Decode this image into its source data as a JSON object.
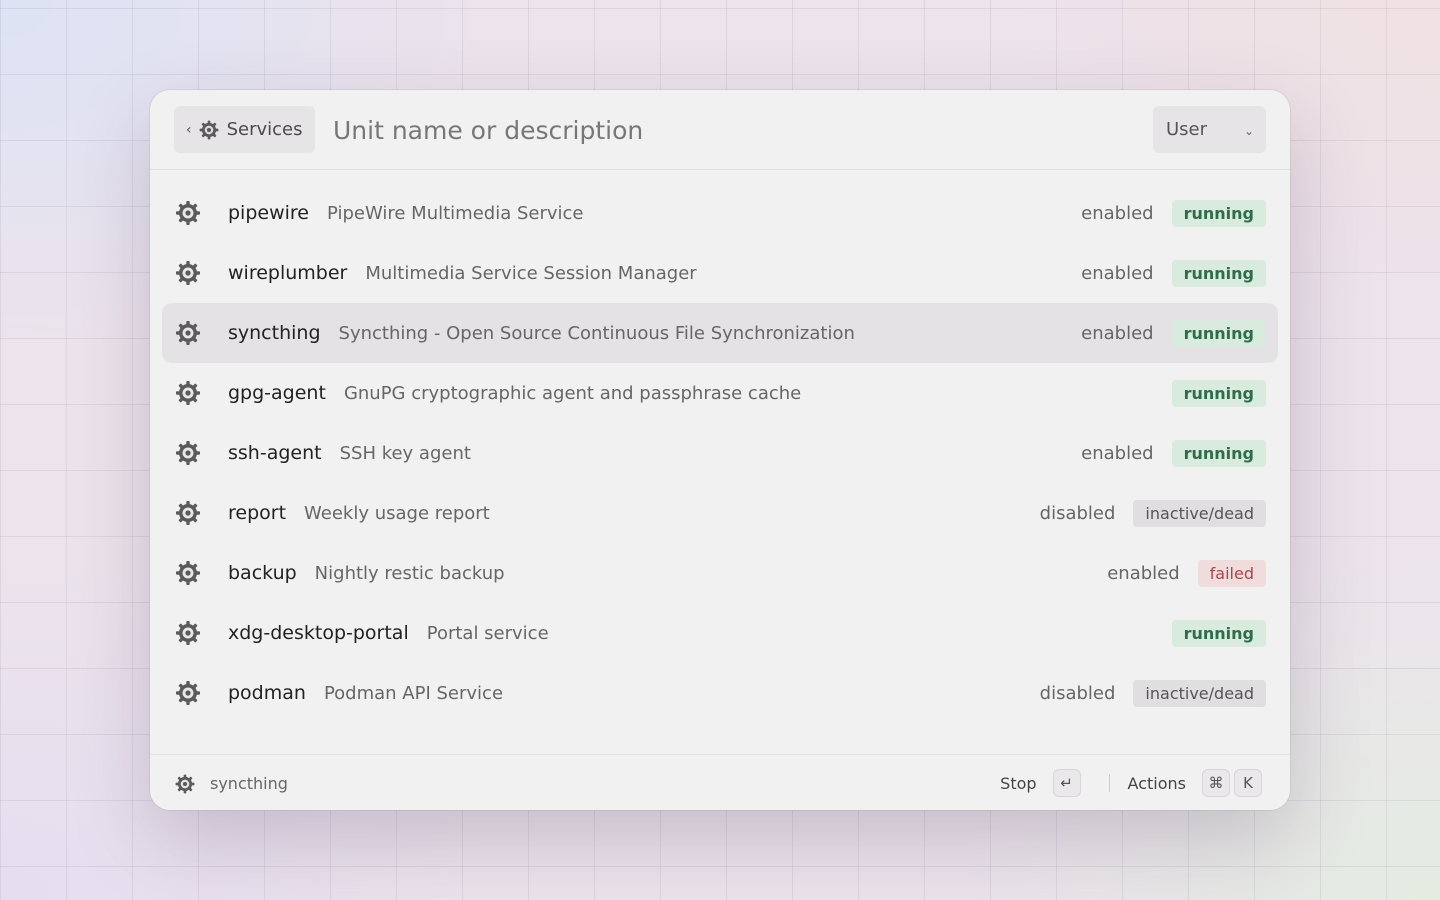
{
  "header": {
    "back_label": "Services",
    "search_placeholder": "Unit name or description",
    "scope_value": "User"
  },
  "services": [
    {
      "name": "pipewire",
      "description": "PipeWire Multimedia Service",
      "enabled": "enabled",
      "status": "running",
      "status_kind": "running",
      "selected": false
    },
    {
      "name": "wireplumber",
      "description": "Multimedia Service Session Manager",
      "enabled": "enabled",
      "status": "running",
      "status_kind": "running",
      "selected": false
    },
    {
      "name": "syncthing",
      "description": "Syncthing - Open Source Continuous File Synchronization",
      "enabled": "enabled",
      "status": "running",
      "status_kind": "running",
      "selected": true
    },
    {
      "name": "gpg-agent",
      "description": "GnuPG cryptographic agent and passphrase cache",
      "enabled": "",
      "status": "running",
      "status_kind": "running",
      "selected": false
    },
    {
      "name": "ssh-agent",
      "description": "SSH key agent",
      "enabled": "enabled",
      "status": "running",
      "status_kind": "running",
      "selected": false
    },
    {
      "name": "report",
      "description": "Weekly usage report",
      "enabled": "disabled",
      "status": "inactive/dead",
      "status_kind": "inactive",
      "selected": false
    },
    {
      "name": "backup",
      "description": "Nightly restic backup",
      "enabled": "enabled",
      "status": "failed",
      "status_kind": "failed",
      "selected": false
    },
    {
      "name": "xdg-desktop-portal",
      "description": "Portal service",
      "enabled": "",
      "status": "running",
      "status_kind": "running",
      "selected": false
    },
    {
      "name": "podman",
      "description": "Podman API Service",
      "enabled": "disabled",
      "status": "inactive/dead",
      "status_kind": "inactive",
      "selected": false
    }
  ],
  "footer": {
    "selected_name": "syncthing",
    "primary_action": "Stop",
    "primary_key": "↵",
    "actions_label": "Actions",
    "actions_keys": [
      "⌘",
      "K"
    ]
  }
}
